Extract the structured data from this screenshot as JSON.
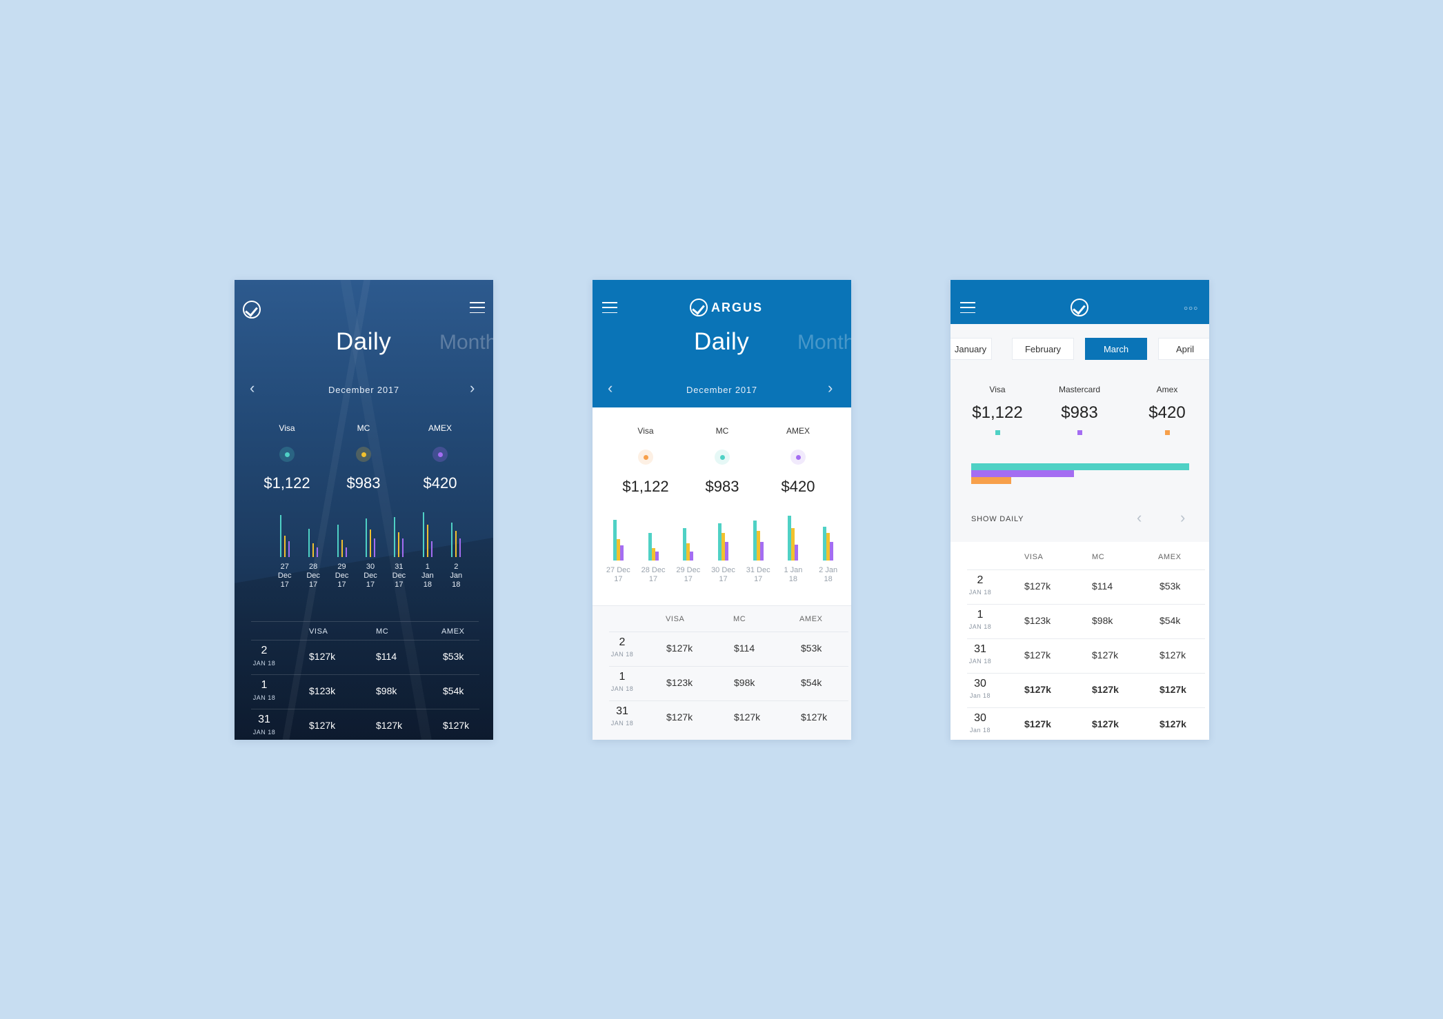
{
  "colors": {
    "background": "#c7ddf1",
    "primary": "#0a74b7",
    "teal": "#4fd1c5",
    "yellow": "#f2c12e",
    "purple": "#a46df2",
    "orange": "#f7a04b"
  },
  "screen1": {
    "tab_active": "Daily",
    "tab_next": "Month",
    "period": "December 2017",
    "metrics": [
      {
        "label": "Visa",
        "value": "$1,122"
      },
      {
        "label": "MC",
        "value": "$983"
      },
      {
        "label": "AMEX",
        "value": "$420"
      }
    ],
    "bar_dates": [
      [
        "27",
        "Dec",
        "17"
      ],
      [
        "28",
        "Dec",
        "17"
      ],
      [
        "29",
        "Dec",
        "17"
      ],
      [
        "30",
        "Dec",
        "17"
      ],
      [
        "31",
        "Dec",
        "17"
      ],
      [
        "1",
        "Jan",
        "18"
      ],
      [
        "2",
        "Jan",
        "18"
      ]
    ],
    "table_headers": [
      "VISA",
      "MC",
      "AMEX"
    ],
    "rows": [
      {
        "day": "2",
        "sub": "JAN 18",
        "visa": "$127k",
        "mc": "$114",
        "amex": "$53k"
      },
      {
        "day": "1",
        "sub": "JAN 18",
        "visa": "$123k",
        "mc": "$98k",
        "amex": "$54k"
      },
      {
        "day": "31",
        "sub": "JAN 18",
        "visa": "$127k",
        "mc": "$127k",
        "amex": "$127k"
      }
    ]
  },
  "screen2": {
    "brand": "ARGUS",
    "tab_active": "Daily",
    "tab_next": "Month",
    "period": "December 2017",
    "metrics": [
      {
        "label": "Visa",
        "value": "$1,122"
      },
      {
        "label": "MC",
        "value": "$983"
      },
      {
        "label": "AMEX",
        "value": "$420"
      }
    ],
    "bar_dates": [
      [
        "27 Dec",
        "17"
      ],
      [
        "28 Dec",
        "17"
      ],
      [
        "29 Dec",
        "17"
      ],
      [
        "30 Dec",
        "17"
      ],
      [
        "31 Dec",
        "17"
      ],
      [
        "1 Jan",
        "18"
      ],
      [
        "2 Jan",
        "18"
      ]
    ],
    "table_headers": [
      "VISA",
      "MC",
      "AMEX"
    ],
    "rows": [
      {
        "day": "2",
        "sub": "JAN 18",
        "visa": "$127k",
        "mc": "$114",
        "amex": "$53k"
      },
      {
        "day": "1",
        "sub": "JAN 18",
        "visa": "$123k",
        "mc": "$98k",
        "amex": "$54k"
      },
      {
        "day": "31",
        "sub": "JAN 18",
        "visa": "$127k",
        "mc": "$127k",
        "amex": "$127k"
      }
    ]
  },
  "screen3": {
    "months": [
      "January",
      "February",
      "March",
      "April"
    ],
    "active_month": "March",
    "metrics": [
      {
        "label": "Visa",
        "value": "$1,122"
      },
      {
        "label": "Mastercard",
        "value": "$983"
      },
      {
        "label": "Amex",
        "value": "$420"
      }
    ],
    "show_daily": "SHOW DAILY",
    "table_headers": [
      "VISA",
      "MC",
      "AMEX"
    ],
    "rows": [
      {
        "day": "2",
        "sub": "JAN 18",
        "visa": "$127k",
        "mc": "$114",
        "amex": "$53k"
      },
      {
        "day": "1",
        "sub": "JAN 18",
        "visa": "$123k",
        "mc": "$98k",
        "amex": "$54k"
      },
      {
        "day": "31",
        "sub": "JAN 18",
        "visa": "$127k",
        "mc": "$127k",
        "amex": "$127k"
      },
      {
        "day": "30",
        "sub": "Jan 18",
        "visa": "$127k",
        "mc": "$127k",
        "amex": "$127k"
      },
      {
        "day": "30",
        "sub": "Jan 18",
        "visa": "$127k",
        "mc": "$127k",
        "amex": "$127k"
      }
    ]
  },
  "chart_data": [
    {
      "type": "bar",
      "categories": [
        "27 Dec 17",
        "28 Dec 17",
        "29 Dec 17",
        "30 Dec 17",
        "31 Dec 17",
        "1 Jan 18",
        "2 Jan 18"
      ],
      "series": [
        {
          "name": "Visa",
          "values": [
            68,
            46,
            52,
            62,
            64,
            72,
            56
          ]
        },
        {
          "name": "MC",
          "values": [
            34,
            22,
            28,
            44,
            40,
            52,
            42
          ]
        },
        {
          "name": "AMEX",
          "values": [
            26,
            16,
            16,
            30,
            30,
            26,
            30
          ]
        }
      ]
    },
    {
      "type": "bar",
      "categories": [
        "27 Dec 17",
        "28 Dec 17",
        "29 Dec 17",
        "30 Dec 17",
        "31 Dec 17",
        "1 Jan 18",
        "2 Jan 18"
      ],
      "series": [
        {
          "name": "Visa",
          "values": [
            66,
            44,
            52,
            60,
            64,
            72,
            54
          ]
        },
        {
          "name": "MC",
          "values": [
            34,
            20,
            28,
            44,
            48,
            52,
            44
          ]
        },
        {
          "name": "AMEX",
          "values": [
            24,
            14,
            14,
            30,
            30,
            26,
            30
          ]
        }
      ]
    },
    {
      "type": "bar",
      "categories": [
        "Visa",
        "Mastercard",
        "Amex"
      ],
      "series": [
        {
          "values": [
            1122,
            983,
            420
          ]
        }
      ]
    }
  ]
}
